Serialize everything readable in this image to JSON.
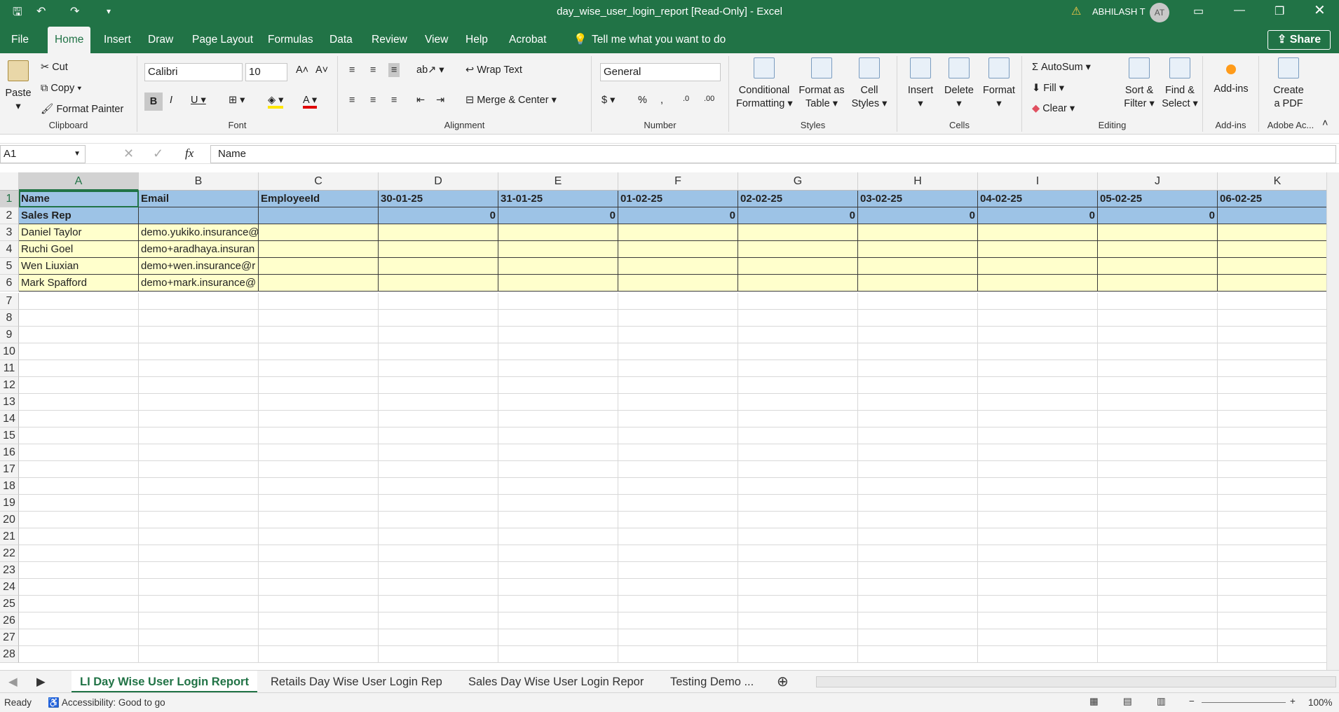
{
  "titlebar": {
    "title": "day_wise_user_login_report  [Read-Only]  -  Excel",
    "user": "ABHILASH T",
    "initials": "AT"
  },
  "menu": [
    "File",
    "Home",
    "Insert",
    "Draw",
    "Page Layout",
    "Formulas",
    "Data",
    "Review",
    "View",
    "Help",
    "Acrobat"
  ],
  "tellme": "Tell me what you want to do",
  "share": "Share",
  "clipboard": {
    "paste": "Paste",
    "cut": "Cut",
    "copy": "Copy",
    "painter": "Format Painter",
    "label": "Clipboard"
  },
  "font": {
    "name": "Calibri",
    "size": "10",
    "label": "Font"
  },
  "alignment": {
    "wrap": "Wrap Text",
    "merge": "Merge & Center",
    "label": "Alignment"
  },
  "number": {
    "format": "General",
    "label": "Number"
  },
  "styles": {
    "cond1": "Conditional",
    "cond2": "Formatting",
    "table1": "Format as",
    "table2": "Table",
    "cell1": "Cell",
    "cell2": "Styles",
    "label": "Styles"
  },
  "cells": {
    "insert": "Insert",
    "delete": "Delete",
    "format": "Format",
    "label": "Cells"
  },
  "editing": {
    "autosum": "AutoSum",
    "fill": "Fill",
    "clear": "Clear",
    "sort1": "Sort &",
    "sort2": "Filter",
    "find1": "Find &",
    "find2": "Select",
    "label": "Editing"
  },
  "addins": {
    "btn": "Add-ins",
    "label": "Add-ins"
  },
  "acrobat": {
    "b1": "Create",
    "b2": "a PDF",
    "label": "Adobe Ac..."
  },
  "formulabar": {
    "namebox": "A1",
    "fx": "fx",
    "value": "Name"
  },
  "columns": [
    "A",
    "B",
    "C",
    "D",
    "E",
    "F",
    "G",
    "H",
    "I",
    "J",
    "K"
  ],
  "header_row": [
    "Name",
    "Email",
    "EmployeeId",
    "30-01-25",
    "31-01-25",
    "01-02-25",
    "02-02-25",
    "03-02-25",
    "04-02-25",
    "05-02-25",
    "06-02-25"
  ],
  "group_row": {
    "label": "Sales Rep",
    "values": [
      "0",
      "0",
      "0",
      "0",
      "0",
      "0",
      "0"
    ]
  },
  "data_rows": [
    {
      "name": "Daniel Taylor",
      "email": "demo.yukiko.insurance@"
    },
    {
      "name": "Ruchi Goel",
      "email": "demo+aradhaya.insuran"
    },
    {
      "name": "Wen Liuxian",
      "email": "demo+wen.insurance@r"
    },
    {
      "name": "Mark Spafford",
      "email": "demo+mark.insurance@"
    }
  ],
  "sheets": [
    "LI Day Wise User Login Report",
    "Retails Day Wise User Login Rep",
    "Sales Day Wise User Login Repor",
    "Testing Demo ..."
  ],
  "status": {
    "ready": "Ready",
    "accessibility": "Accessibility: Good to go",
    "zoom": "100%"
  }
}
